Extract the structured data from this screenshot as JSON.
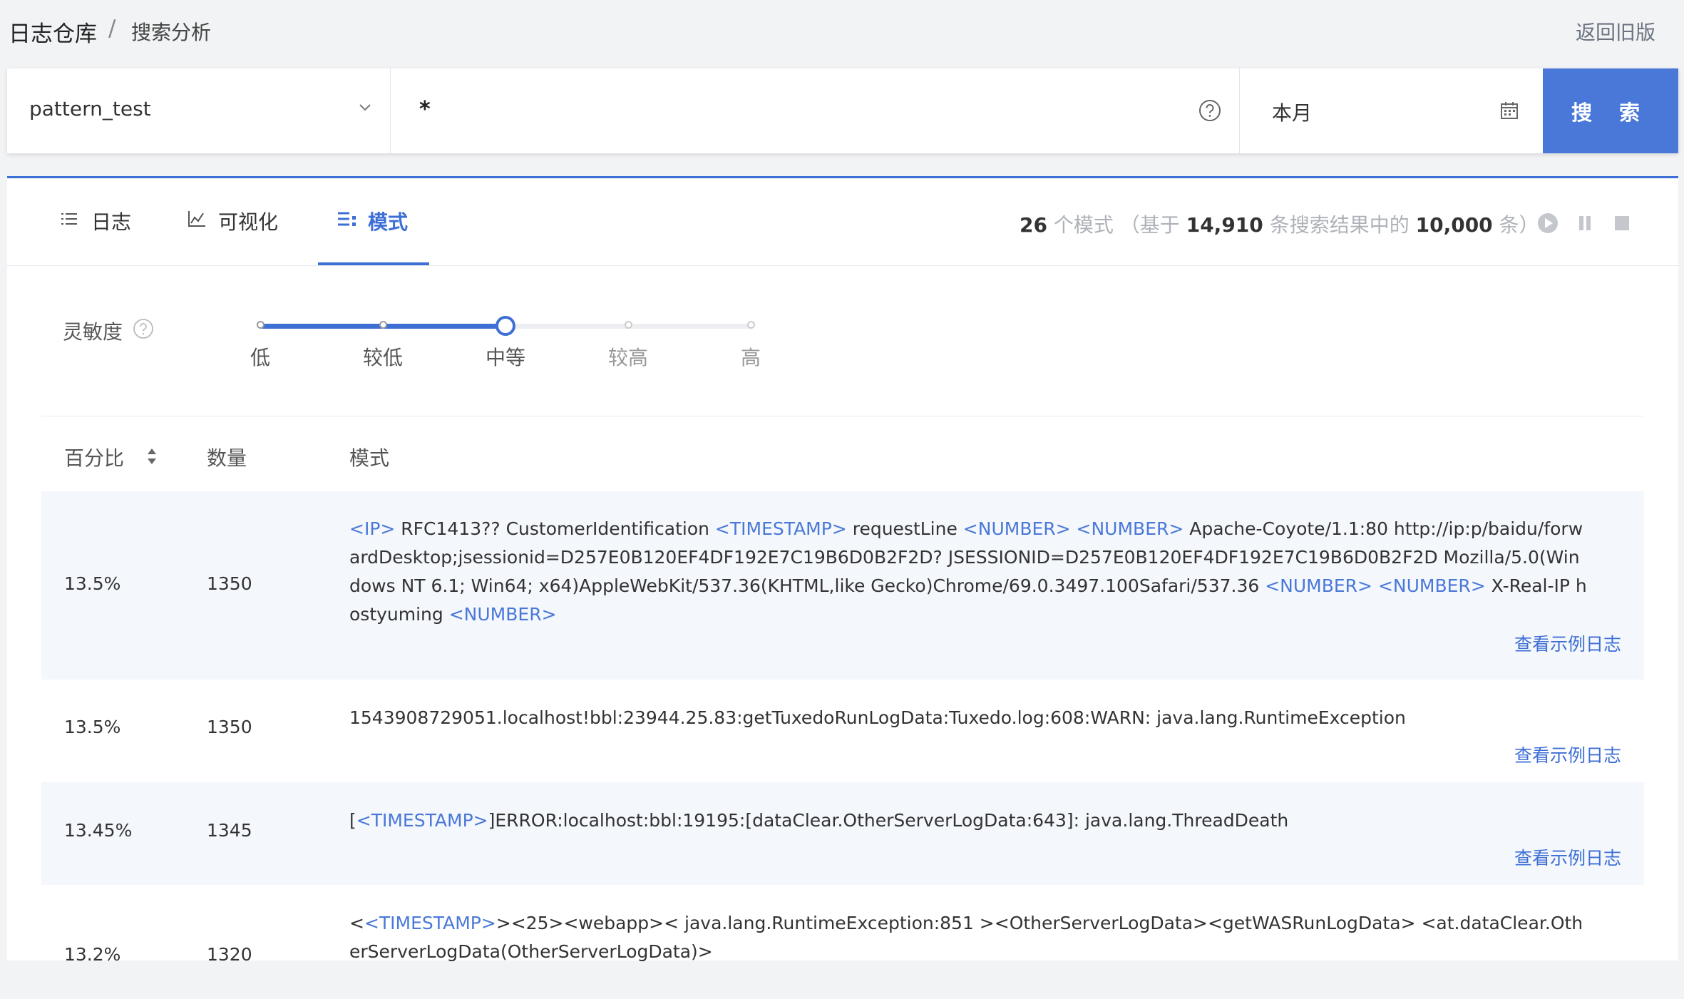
{
  "breadcrumb": {
    "root": "日志仓库",
    "separator": "/",
    "current": "搜索分析"
  },
  "header": {
    "back_link": "返回旧版"
  },
  "search": {
    "dataset": "pattern_test",
    "query": "*",
    "time_range": "本月",
    "button": "搜 索"
  },
  "tabs": [
    {
      "label": "日志",
      "icon": "list-icon"
    },
    {
      "label": "可视化",
      "icon": "line-chart-icon"
    },
    {
      "label": "模式",
      "icon": "pattern-icon",
      "active": true
    }
  ],
  "summary": {
    "count": "26",
    "count_suffix": "个模式",
    "pre": "（基于",
    "total": "14,910",
    "mid": "条搜索结果中的",
    "sample": "10,000",
    "post": "条）"
  },
  "sensitivity": {
    "label": "灵敏度",
    "levels": [
      "低",
      "较低",
      "中等",
      "较高",
      "高"
    ],
    "selected_index": 2
  },
  "table": {
    "headers": {
      "percent": "百分比",
      "count": "数量",
      "pattern": "模式"
    },
    "view_label": "查看示例日志",
    "rows": [
      {
        "percent": "13.5%",
        "count": "1350",
        "pattern": [
          {
            "t": "<IP>",
            "tok": true
          },
          {
            "t": " RFC1413?? CustomerIdentification "
          },
          {
            "t": "<TIMESTAMP>",
            "tok": true
          },
          {
            "t": " requestLine "
          },
          {
            "t": "<NUMBER>",
            "tok": true
          },
          {
            "t": " "
          },
          {
            "t": "<NUMBER>",
            "tok": true
          },
          {
            "t": " Apache-Coyote/1.1:80 http://ip:p/baidu/forwardDesktop;jsessionid=D257E0B120EF4DF192E7C19B6D0B2F2D? JSESSIONID=D257E0B120EF4DF192E7C19B6D0B2F2D Mozilla/5.0(Windows NT 6.1; Win64; x64)AppleWebKit/537.36(KHTML,like Gecko)Chrome/69.0.3497.100Safari/537.36 "
          },
          {
            "t": "<NUMBER>",
            "tok": true
          },
          {
            "t": " "
          },
          {
            "t": "<NUMBER>",
            "tok": true
          },
          {
            "t": " X-Real-IP hostyuming "
          },
          {
            "t": "<NUMBER>",
            "tok": true
          }
        ]
      },
      {
        "percent": "13.5%",
        "count": "1350",
        "pattern": [
          {
            "t": "1543908729051.localhost!bbl:23944.25.83:getTuxedoRunLogData:Tuxedo.log:608:WARN: java.lang.RuntimeException"
          }
        ]
      },
      {
        "percent": "13.45%",
        "count": "1345",
        "pattern": [
          {
            "t": "["
          },
          {
            "t": "<TIMESTAMP>",
            "tok": true
          },
          {
            "t": "]ERROR:localhost:bbl:19195:[dataClear.OtherServerLogData:643]: java.lang.ThreadDeath"
          }
        ]
      },
      {
        "percent": "13.2%",
        "count": "1320",
        "pattern": [
          {
            "t": "<"
          },
          {
            "t": "<TIMESTAMP>",
            "tok": true
          },
          {
            "t": "><25><webapp>< java.lang.RuntimeException:851 ><OtherServerLogData><getWASRunLogData> <at.dataClear.OtherServerLogData(OtherServerLogData)>"
          }
        ]
      }
    ]
  },
  "colors": {
    "accent": "#3e6fd5",
    "token": "#4a78d8",
    "row_alt": "#f4f7fc"
  }
}
